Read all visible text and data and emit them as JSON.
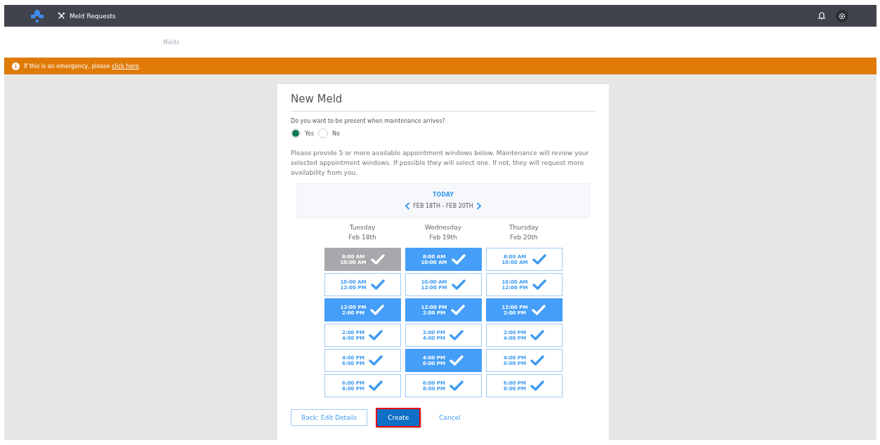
{
  "header": {
    "nav_label": "Meld Requests"
  },
  "subnav": {
    "link": "Melds"
  },
  "alert": {
    "text": "If this is an emergency, please ",
    "link": "click here",
    "suffix": "."
  },
  "form": {
    "title": "New Meld",
    "question": "Do you want to be present when maintenance arrives?",
    "options": [
      {
        "label": "Yes",
        "selected": true
      },
      {
        "label": "No",
        "selected": false
      }
    ],
    "instructions": "Please provide 5 or more available appointment windows below. Maintenance will review your selected appointment windows. If possible they will select one. If not, they will request more availability from you.",
    "calendar": {
      "today": "TODAY",
      "range": "FEB 18TH - FEB 20TH"
    },
    "days": [
      {
        "weekday": "Tuesday",
        "date": "Feb 18th",
        "slots": [
          {
            "start": "8:00 AM",
            "end": "10:00 AM",
            "selected": false,
            "disabled": true
          },
          {
            "start": "10:00 AM",
            "end": "12:00 PM",
            "selected": false,
            "disabled": false
          },
          {
            "start": "12:00 PM",
            "end": "2:00 PM",
            "selected": true,
            "disabled": false
          },
          {
            "start": "2:00 PM",
            "end": "4:00 PM",
            "selected": false,
            "disabled": false
          },
          {
            "start": "4:00 PM",
            "end": "6:00 PM",
            "selected": false,
            "disabled": false
          },
          {
            "start": "6:00 PM",
            "end": "8:00 PM",
            "selected": false,
            "disabled": false
          }
        ]
      },
      {
        "weekday": "Wednesday",
        "date": "Feb 19th",
        "slots": [
          {
            "start": "8:00 AM",
            "end": "10:00 AM",
            "selected": true,
            "disabled": false
          },
          {
            "start": "10:00 AM",
            "end": "12:00 PM",
            "selected": false,
            "disabled": false
          },
          {
            "start": "12:00 PM",
            "end": "2:00 PM",
            "selected": true,
            "disabled": false
          },
          {
            "start": "2:00 PM",
            "end": "4:00 PM",
            "selected": false,
            "disabled": false
          },
          {
            "start": "4:00 PM",
            "end": "6:00 PM",
            "selected": true,
            "disabled": false
          },
          {
            "start": "6:00 PM",
            "end": "8:00 PM",
            "selected": false,
            "disabled": false
          }
        ]
      },
      {
        "weekday": "Thursday",
        "date": "Feb 20th",
        "slots": [
          {
            "start": "8:00 AM",
            "end": "10:00 AM",
            "selected": false,
            "disabled": false
          },
          {
            "start": "10:00 AM",
            "end": "12:00 PM",
            "selected": false,
            "disabled": false
          },
          {
            "start": "12:00 PM",
            "end": "2:00 PM",
            "selected": true,
            "disabled": false
          },
          {
            "start": "2:00 PM",
            "end": "4:00 PM",
            "selected": false,
            "disabled": false
          },
          {
            "start": "4:00 PM",
            "end": "6:00 PM",
            "selected": false,
            "disabled": false
          },
          {
            "start": "6:00 PM",
            "end": "8:00 PM",
            "selected": false,
            "disabled": false
          }
        ]
      }
    ],
    "buttons": [
      {
        "label": "Back: Edit Details",
        "kind": "outline"
      },
      {
        "label": "Create",
        "kind": "primary",
        "highlighted": true
      },
      {
        "label": "Cancel",
        "kind": "link"
      }
    ]
  }
}
